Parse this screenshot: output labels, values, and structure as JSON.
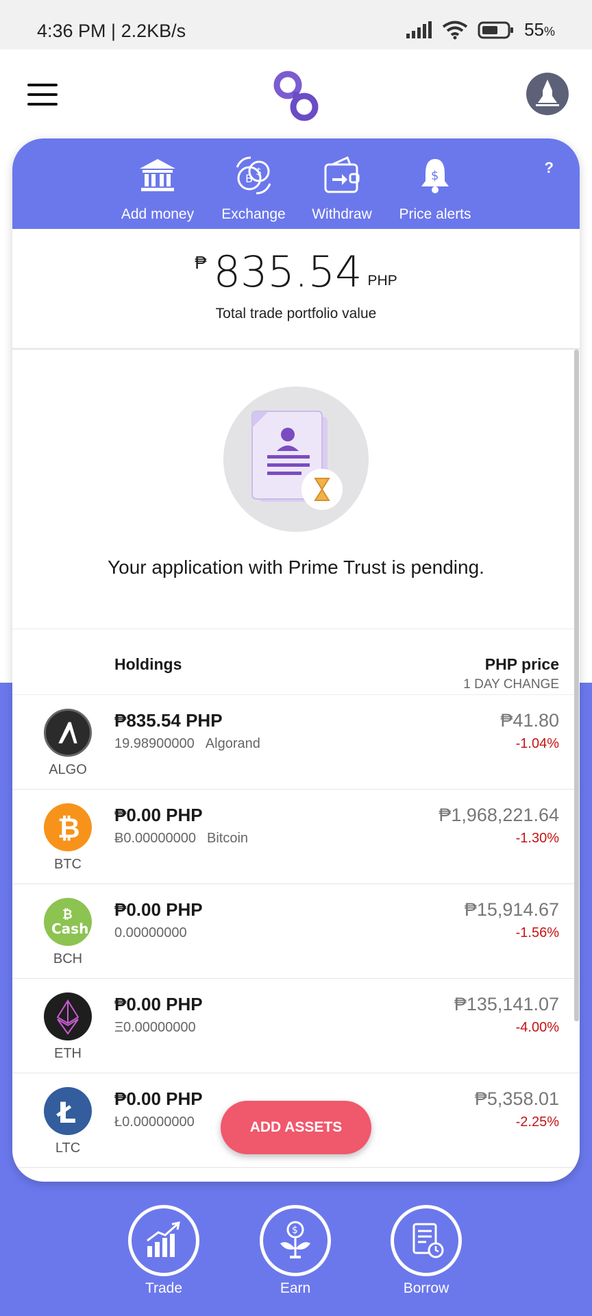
{
  "status_bar": {
    "time_speed": "4:36 PM | 2.2KB/s",
    "battery_pct": "55",
    "battery_unit": "%"
  },
  "header": {
    "menu_icon": "hamburger-menu-icon",
    "logo_icon": "brand-logo-icon",
    "avatar_icon": "rocket-avatar-icon"
  },
  "actions": [
    {
      "label": "Add money",
      "icon": "bank-icon"
    },
    {
      "label": "Exchange",
      "icon": "exchange-icon"
    },
    {
      "label": "Withdraw",
      "icon": "withdraw-icon"
    },
    {
      "label": "Price alerts",
      "icon": "bell-icon"
    }
  ],
  "help_label": "?",
  "portfolio": {
    "currency_symbol": "₱",
    "amount": "835.54",
    "currency_code": "PHP",
    "caption": "Total trade portfolio value"
  },
  "pending_message": "Your application with Prime Trust is pending.",
  "holdings_header": {
    "left": "Holdings",
    "right": "PHP price",
    "right_sub": "1 DAY CHANGE"
  },
  "holdings": [
    {
      "ticker": "ALGO",
      "value": "₱835.54 PHP",
      "quantity": "19.98900000",
      "name": "Algorand",
      "price": "₱41.80",
      "change": "-1.04%",
      "color": "#2b2b2b"
    },
    {
      "ticker": "BTC",
      "value": "₱0.00 PHP",
      "quantity": "Ƀ0.00000000",
      "name": "Bitcoin",
      "price": "₱1,968,221.64",
      "change": "-1.30%",
      "color": "#f7931a"
    },
    {
      "ticker": "BCH",
      "value": "₱0.00 PHP",
      "quantity": "0.00000000",
      "name": "",
      "price": "₱15,914.67",
      "change": "-1.56%",
      "color": "#8dc351"
    },
    {
      "ticker": "ETH",
      "value": "₱0.00 PHP",
      "quantity": "Ξ0.00000000",
      "name": "",
      "price": "₱135,141.07",
      "change": "-4.00%",
      "color": "#1e1e1e"
    },
    {
      "ticker": "LTC",
      "value": "₱0.00 PHP",
      "quantity": "Ł0.00000000",
      "name": "",
      "price": "₱5,358.01",
      "change": "-2.25%",
      "color": "#345d9d"
    }
  ],
  "add_assets_label": "ADD ASSETS",
  "bottom_nav": [
    {
      "label": "Trade",
      "icon": "trade-chart-icon"
    },
    {
      "label": "Earn",
      "icon": "earn-plant-icon"
    },
    {
      "label": "Borrow",
      "icon": "borrow-document-icon"
    }
  ],
  "colors": {
    "brand": "#6b78ec",
    "accent_button": "#f0586c",
    "negative": "#c41414"
  }
}
